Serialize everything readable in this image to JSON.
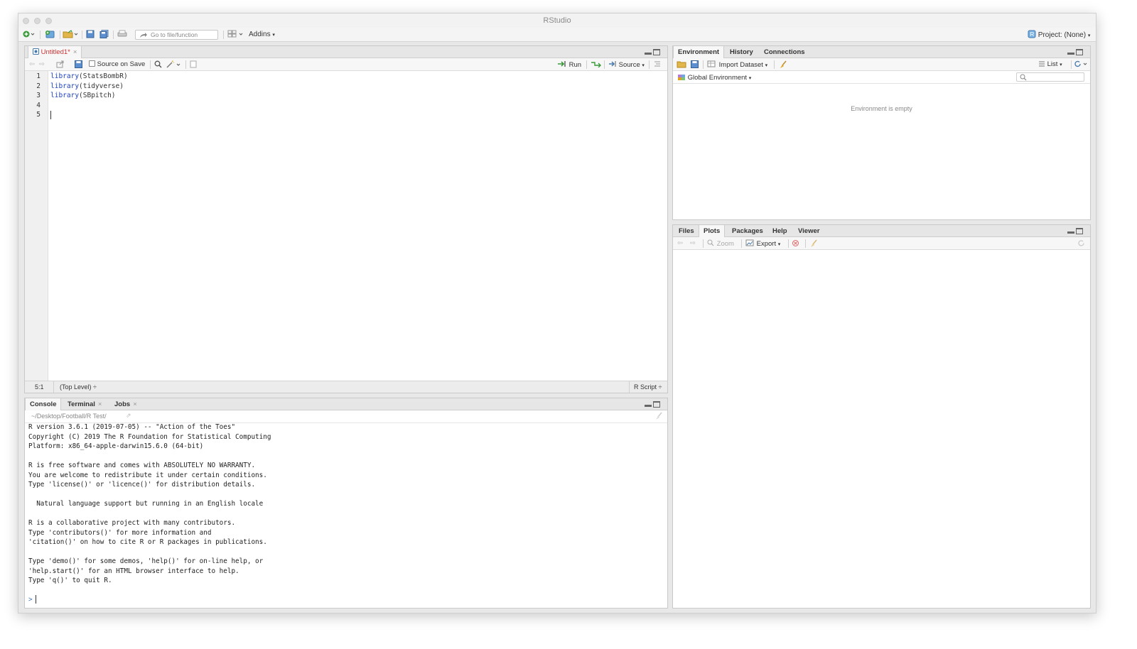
{
  "window": {
    "title": "RStudio"
  },
  "toolbar": {
    "goto_placeholder": "Go to file/function",
    "addins_label": "Addins",
    "project_label": "Project: (None)"
  },
  "editor": {
    "tab_label": "Untitled1*",
    "source_on_save_label": "Source on Save",
    "run_label": "Run",
    "source_label": "Source",
    "lines": [
      {
        "num": "1",
        "fn": "library",
        "arg": "(StatsBombR)"
      },
      {
        "num": "2",
        "fn": "library",
        "arg": "(tidyverse)"
      },
      {
        "num": "3",
        "fn": "library",
        "arg": "(SBpitch)"
      },
      {
        "num": "4",
        "fn": "",
        "arg": ""
      },
      {
        "num": "5",
        "fn": "",
        "arg": ""
      }
    ],
    "status": {
      "position": "5:1",
      "scope": "(Top Level) ÷",
      "filetype": "R Script ÷"
    }
  },
  "console": {
    "tabs": [
      {
        "label": "Console"
      },
      {
        "label": "Terminal"
      },
      {
        "label": "Jobs"
      }
    ],
    "path": "~/Desktop/Football/R Test/",
    "output": "R version 3.6.1 (2019-07-05) -- \"Action of the Toes\"\nCopyright (C) 2019 The R Foundation for Statistical Computing\nPlatform: x86_64-apple-darwin15.6.0 (64-bit)\n\nR is free software and comes with ABSOLUTELY NO WARRANTY.\nYou are welcome to redistribute it under certain conditions.\nType 'license()' or 'licence()' for distribution details.\n\n  Natural language support but running in an English locale\n\nR is a collaborative project with many contributors.\nType 'contributors()' for more information and\n'citation()' on how to cite R or R packages in publications.\n\nType 'demo()' for some demos, 'help()' for on-line help, or\n'help.start()' for an HTML browser interface to help.\nType 'q()' to quit R.",
    "prompt": ">"
  },
  "environment": {
    "tabs": [
      {
        "label": "Environment"
      },
      {
        "label": "History"
      },
      {
        "label": "Connections"
      }
    ],
    "import_label": "Import Dataset",
    "list_label": "List",
    "global_env_label": "Global Environment",
    "empty_message": "Environment is empty"
  },
  "files": {
    "tabs": [
      {
        "label": "Files"
      },
      {
        "label": "Plots"
      },
      {
        "label": "Packages"
      },
      {
        "label": "Help"
      },
      {
        "label": "Viewer"
      }
    ],
    "zoom_label": "Zoom",
    "export_label": "Export"
  },
  "colors": {
    "accent_green": "#3a9a3a",
    "keyword_blue": "#1a3fbf",
    "tab_active_text": "#c33"
  }
}
